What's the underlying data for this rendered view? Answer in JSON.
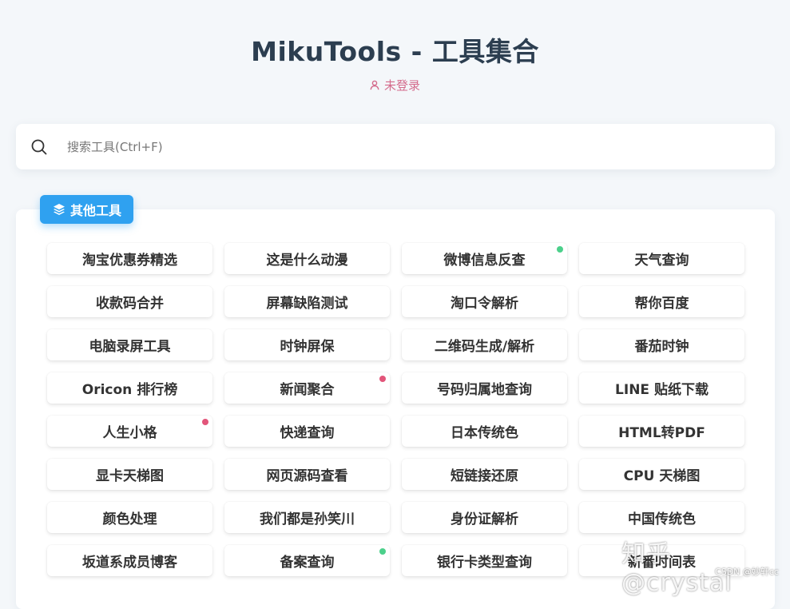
{
  "header": {
    "title": "MikuTools - 工具集合",
    "login_status": "未登录",
    "login_color": "#d46b8c"
  },
  "search": {
    "placeholder": "搜索工具(Ctrl+F)",
    "value": ""
  },
  "category": {
    "label": "其他工具",
    "icon": "layers-icon",
    "color": "#2fa1f0"
  },
  "status_colors": {
    "green": "#4cd08b",
    "red": "#e2557a"
  },
  "tools": [
    {
      "label": "淘宝优惠券精选",
      "dot": null
    },
    {
      "label": "这是什么动漫",
      "dot": null
    },
    {
      "label": "微博信息反查",
      "dot": "green"
    },
    {
      "label": "天气查询",
      "dot": null
    },
    {
      "label": "收款码合并",
      "dot": null
    },
    {
      "label": "屏幕缺陷测试",
      "dot": null
    },
    {
      "label": "淘口令解析",
      "dot": null
    },
    {
      "label": "帮你百度",
      "dot": null
    },
    {
      "label": "电脑录屏工具",
      "dot": null
    },
    {
      "label": "时钟屏保",
      "dot": null
    },
    {
      "label": "二维码生成/解析",
      "dot": null
    },
    {
      "label": "番茄时钟",
      "dot": null
    },
    {
      "label": "Oricon 排行榜",
      "dot": null
    },
    {
      "label": "新闻聚合",
      "dot": "red"
    },
    {
      "label": "号码归属地查询",
      "dot": null
    },
    {
      "label": "LINE 贴纸下载",
      "dot": null
    },
    {
      "label": "人生小格",
      "dot": "red"
    },
    {
      "label": "快递查询",
      "dot": null
    },
    {
      "label": "日本传统色",
      "dot": null
    },
    {
      "label": "HTML转PDF",
      "dot": null
    },
    {
      "label": "显卡天梯图",
      "dot": null
    },
    {
      "label": "网页源码查看",
      "dot": null
    },
    {
      "label": "短链接还原",
      "dot": null
    },
    {
      "label": "CPU 天梯图",
      "dot": null
    },
    {
      "label": "颜色处理",
      "dot": null
    },
    {
      "label": "我们都是孙笑川",
      "dot": null
    },
    {
      "label": "身份证解析",
      "dot": null
    },
    {
      "label": "中国传统色",
      "dot": null
    },
    {
      "label": "坂道系成员博客",
      "dot": null
    },
    {
      "label": "备案查询",
      "dot": "green"
    },
    {
      "label": "银行卡类型查询",
      "dot": null
    },
    {
      "label": "新番时间表",
      "dot": null
    }
  ],
  "watermark": {
    "zhihu": "知乎 @crystal",
    "csdn": "CSDN @妙轩cc"
  }
}
